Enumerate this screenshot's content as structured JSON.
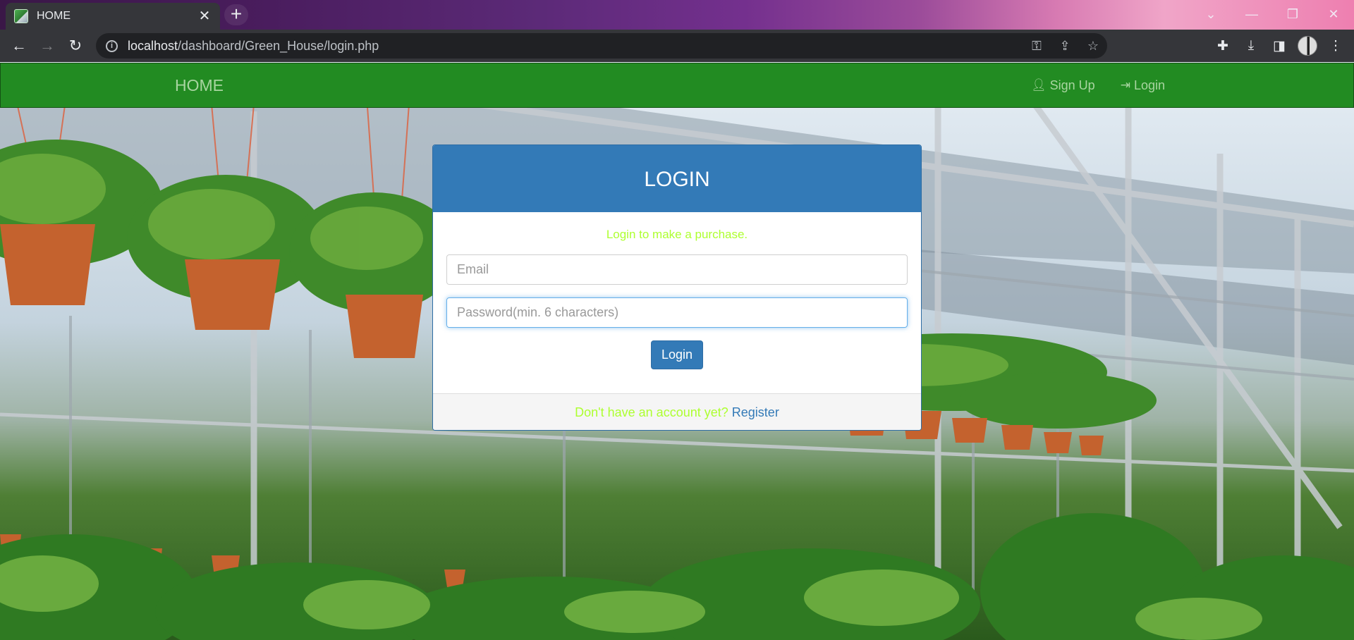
{
  "browser": {
    "tab_title": "HOME",
    "tab_close": "✕",
    "new_tab": "+",
    "url_host": "localhost",
    "url_path": "/dashboard/Green_House/login.php",
    "window_controls": {
      "dropdown": "⌄",
      "minimize": "—",
      "restore": "❐",
      "close": "✕"
    }
  },
  "nav": {
    "brand": "HOME",
    "signup_label": "Sign Up",
    "login_label": "Login"
  },
  "login": {
    "heading": "LOGIN",
    "subtitle": "Login to make a purchase.",
    "email_placeholder": "Email",
    "password_placeholder": "Password(min. 6 characters)",
    "submit_label": "Login",
    "footer_text": "Don't have an account yet?",
    "footer_link": "Register"
  },
  "colors": {
    "navbar": "#228b22",
    "panel_heading": "#337ab7",
    "accent_text": "#adff2f"
  }
}
